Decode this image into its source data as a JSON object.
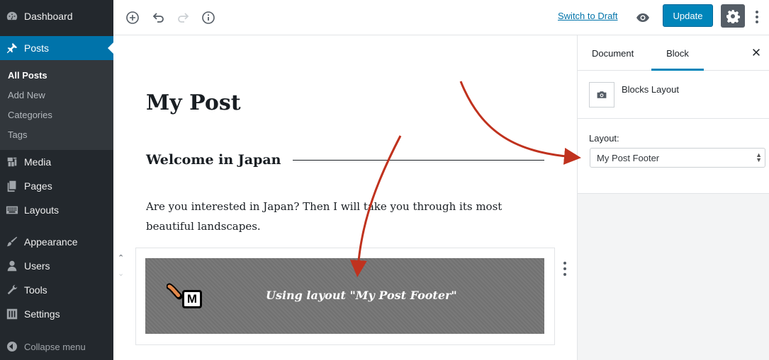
{
  "sidebar": {
    "items": [
      {
        "label": "Dashboard",
        "icon": "dashboard-icon"
      },
      {
        "label": "Posts",
        "icon": "pin-icon"
      },
      {
        "label": "Media",
        "icon": "media-icon"
      },
      {
        "label": "Pages",
        "icon": "pages-icon"
      },
      {
        "label": "Layouts",
        "icon": "keyboard-icon"
      },
      {
        "label": "Appearance",
        "icon": "brush-icon"
      },
      {
        "label": "Users",
        "icon": "user-icon"
      },
      {
        "label": "Tools",
        "icon": "wrench-icon"
      },
      {
        "label": "Settings",
        "icon": "settings-sliders-icon"
      }
    ],
    "submenu": [
      "All Posts",
      "Add New",
      "Categories",
      "Tags"
    ],
    "collapse_label": "Collapse menu"
  },
  "toolbar": {
    "switch_draft": "Switch to Draft",
    "update": "Update"
  },
  "editor": {
    "title": "My Post",
    "heading": "Welcome in Japan",
    "paragraph": "Are you interested in Japan? Then I will take you through its most beautiful landscapes.",
    "layout_block_text": "Using layout \"My Post Footer\"",
    "logo_letter": "M"
  },
  "panel": {
    "tabs": [
      "Document",
      "Block"
    ],
    "active_tab": "Block",
    "block_name": "Blocks Layout",
    "layout_label": "Layout:",
    "layout_value": "My Post Footer"
  },
  "colors": {
    "sidebar_bg": "#23282d",
    "accent": "#0073aa",
    "update_button": "#0085ba",
    "arrow": "#c0321e"
  }
}
